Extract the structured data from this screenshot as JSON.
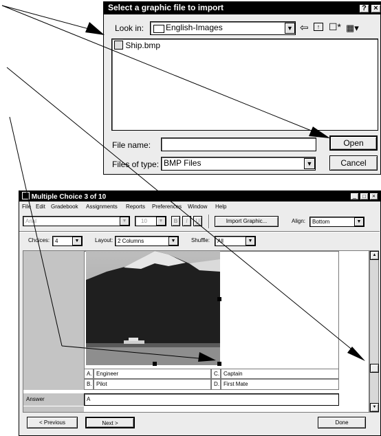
{
  "file_dialog": {
    "title": "Select a graphic file to import",
    "help": "?",
    "close": "×",
    "look_in_label": "Look in:",
    "look_in_value": "English-Images",
    "files": [
      "Ship.bmp"
    ],
    "file_name_label": "File name:",
    "file_name_value": "",
    "files_of_type_label": "Files of type:",
    "files_of_type_value": "BMP Files",
    "open_label": "Open",
    "cancel_label": "Cancel"
  },
  "main_window": {
    "title": "Multiple Choice  3 of 10",
    "controls": [
      "_",
      "□",
      "×"
    ],
    "menu": [
      "File",
      "Edit",
      "Gradebook",
      "Assignments",
      "Reports",
      "Preferences",
      "Window",
      "Help"
    ],
    "font_value": "Arial",
    "size_value": "10",
    "bold_label": "B",
    "italic_label": "I",
    "underline_label": "U",
    "import_graphic_label": "Import Graphic...",
    "align_label": "Align:",
    "align_value": "Bottom",
    "choices_label": "Choices:",
    "choices_value": "4",
    "layout_label": "Layout:",
    "layout_value": "2 Columns",
    "shuffle_label": "Shuffle:",
    "shuffle_value": "All",
    "answers": [
      {
        "letter": "A.",
        "text": "Engineer"
      },
      {
        "letter": "C.",
        "text": "Captain"
      },
      {
        "letter": "B.",
        "text": "Pilot"
      },
      {
        "letter": "D.",
        "text": "First Mate"
      }
    ],
    "answer_label": "Answer",
    "answer_value": "A",
    "previous_label": "< Previous",
    "next_label": "Next >",
    "done_label": "Done"
  }
}
